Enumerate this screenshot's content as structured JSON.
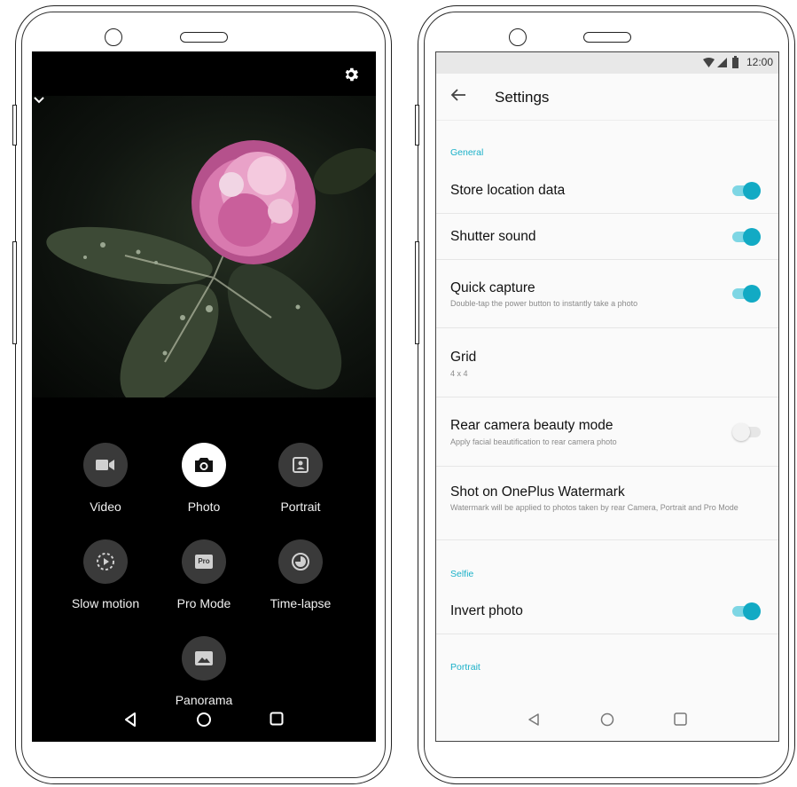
{
  "camera": {
    "modes": [
      {
        "label": "Video",
        "icon": "video-icon",
        "active": false
      },
      {
        "label": "Photo",
        "icon": "camera-icon",
        "active": true
      },
      {
        "label": "Portrait",
        "icon": "portrait-icon",
        "active": false
      },
      {
        "label": "Slow motion",
        "icon": "slow-motion-icon",
        "active": false
      },
      {
        "label": "Pro Mode",
        "icon": "pro-icon",
        "active": false
      },
      {
        "label": "Time-lapse",
        "icon": "time-lapse-icon",
        "active": false
      },
      {
        "label": "Panorama",
        "icon": "panorama-icon",
        "active": false
      }
    ],
    "pro_badge": "Pro"
  },
  "settings": {
    "status_time": "12:00",
    "title": "Settings",
    "section_general": "General",
    "store_location": {
      "title": "Store location data",
      "on": true
    },
    "shutter_sound": {
      "title": "Shutter sound",
      "on": true
    },
    "quick_capture": {
      "title": "Quick capture",
      "subtitle": "Double-tap the power button to instantly take a photo",
      "on": true
    },
    "grid": {
      "title": "Grid",
      "subtitle": "4 x 4"
    },
    "rear_beauty": {
      "title": "Rear camera beauty mode",
      "subtitle": "Apply facial beautification to rear camera photo",
      "on": false
    },
    "watermark": {
      "title": "Shot on OnePlus Watermark",
      "subtitle": "Watermark will be applied to photos taken by rear Camera, Portrait and Pro Mode"
    },
    "section_selfie": "Selfie",
    "invert_photo": {
      "title": "Invert photo",
      "on": true
    },
    "section_portrait": "Portrait"
  },
  "colors": {
    "accent": "#12aac4",
    "accent_track": "#7ed6e4",
    "camera_bg": "#000000",
    "settings_bg": "#fafafa"
  }
}
